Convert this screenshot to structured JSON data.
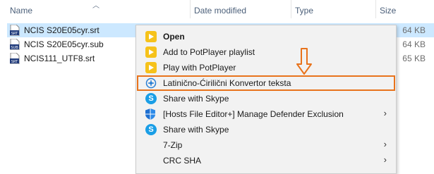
{
  "columns": {
    "name": "Name",
    "date_modified": "Date modified",
    "type": "Type",
    "size": "Size"
  },
  "files": [
    {
      "name": "NCIS S20E05cyr.srt",
      "size": "64 KB",
      "icon": "srt-file-icon",
      "badge": "SRT",
      "selected": true
    },
    {
      "name": "NCIS S20E05cyr.sub",
      "size": "64 KB",
      "icon": "sub-file-icon",
      "badge": "SUB",
      "selected": false
    },
    {
      "name": "NCIS111_UTF8.srt",
      "size": "65 KB",
      "icon": "srt-file-icon",
      "badge": "SRT",
      "selected": false
    }
  ],
  "menu": {
    "items": [
      {
        "label": "Open",
        "icon": "potplayer-icon",
        "bold": true
      },
      {
        "label": "Add to PotPlayer playlist",
        "icon": "potplayer-icon"
      },
      {
        "label": "Play with PotPlayer",
        "icon": "potplayer-icon"
      },
      {
        "label": "Latinično-Ćirilični Konvertor teksta",
        "icon": "converter-icon",
        "highlighted": true
      },
      {
        "label": "Share with Skype",
        "icon": "skype-icon"
      },
      {
        "label": "[Hosts File Editor+] Manage Defender Exclusion",
        "icon": "defender-shield-icon",
        "submenu": true
      },
      {
        "label": "Share with Skype",
        "icon": "skype-icon"
      },
      {
        "label": "7-Zip",
        "submenu": true
      },
      {
        "label": "CRC SHA",
        "submenu": true
      }
    ],
    "submenu_arrow": "›"
  },
  "colors": {
    "selection": "#cce8ff",
    "highlight_outline": "#e8731c",
    "menu_bg": "#f2f2f2"
  }
}
